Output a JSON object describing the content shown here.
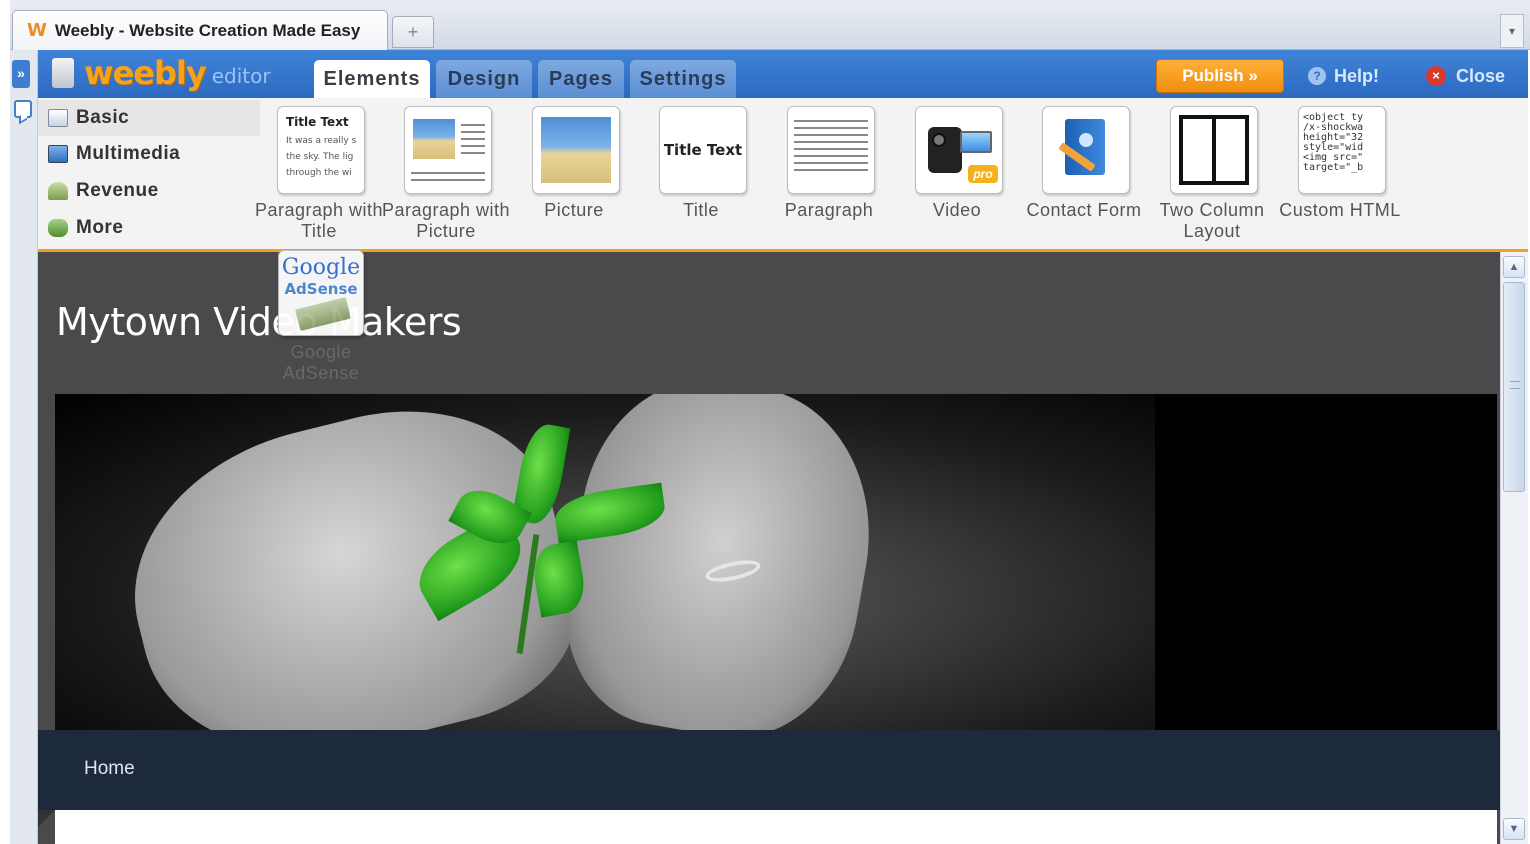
{
  "browser": {
    "tab_title": "Weebly - Website Creation Made Easy",
    "favicon": "W",
    "new_tab_glyph": "+"
  },
  "editor": {
    "logo_text": "weebly",
    "logo_sub": "editor",
    "tabs": [
      {
        "label": "Elements",
        "active": true
      },
      {
        "label": "Design",
        "active": false
      },
      {
        "label": "Pages",
        "active": false
      },
      {
        "label": "Settings",
        "active": false
      }
    ],
    "publish_label": "Publish »",
    "help_label": "Help!",
    "close_label": "Close"
  },
  "palette": {
    "categories": [
      {
        "label": "Basic",
        "icon": "basic-icon",
        "active": true
      },
      {
        "label": "Multimedia",
        "icon": "multimedia-icon",
        "active": false
      },
      {
        "label": "Revenue",
        "icon": "revenue-icon",
        "active": false
      },
      {
        "label": "More",
        "icon": "more-icon",
        "active": false
      }
    ],
    "elements": [
      {
        "label": "Paragraph with Title",
        "icon": "paragraph-with-title-icon"
      },
      {
        "label": "Paragraph with Picture",
        "icon": "paragraph-with-picture-icon"
      },
      {
        "label": "Picture",
        "icon": "picture-icon"
      },
      {
        "label": "Title",
        "icon": "title-icon"
      },
      {
        "label": "Paragraph",
        "icon": "paragraph-icon"
      },
      {
        "label": "Video",
        "icon": "video-icon"
      },
      {
        "label": "Contact Form",
        "icon": "contact-form-icon"
      },
      {
        "label": "Two Column Layout",
        "icon": "two-column-layout-icon"
      },
      {
        "label": "Custom HTML",
        "icon": "custom-html-icon"
      }
    ],
    "thumb_texts": {
      "title_text": "Title Text",
      "title_paragraph_lines": [
        "It was a really s",
        "the sky.  The lig",
        "through the wi"
      ],
      "video_badge": "pro",
      "code_snippet": "<object ty\n/x-shockwa\nheight=\"32\nstyle=\"wid\n<img src=\"\ntarget=\"_b"
    }
  },
  "drag_ghost": {
    "label": "Google AdSense",
    "google_text": "Google",
    "adsense_text": "AdSense"
  },
  "site": {
    "title": "Mytown Video Makers",
    "nav": [
      "Home"
    ]
  },
  "colors": {
    "accent_orange": "#f0a020",
    "editor_blue": "#2c69c0",
    "publish_orange": "#f08e0e",
    "site_header_gray": "#4a4a4c",
    "site_nav_navy": "#1c2a3c"
  }
}
